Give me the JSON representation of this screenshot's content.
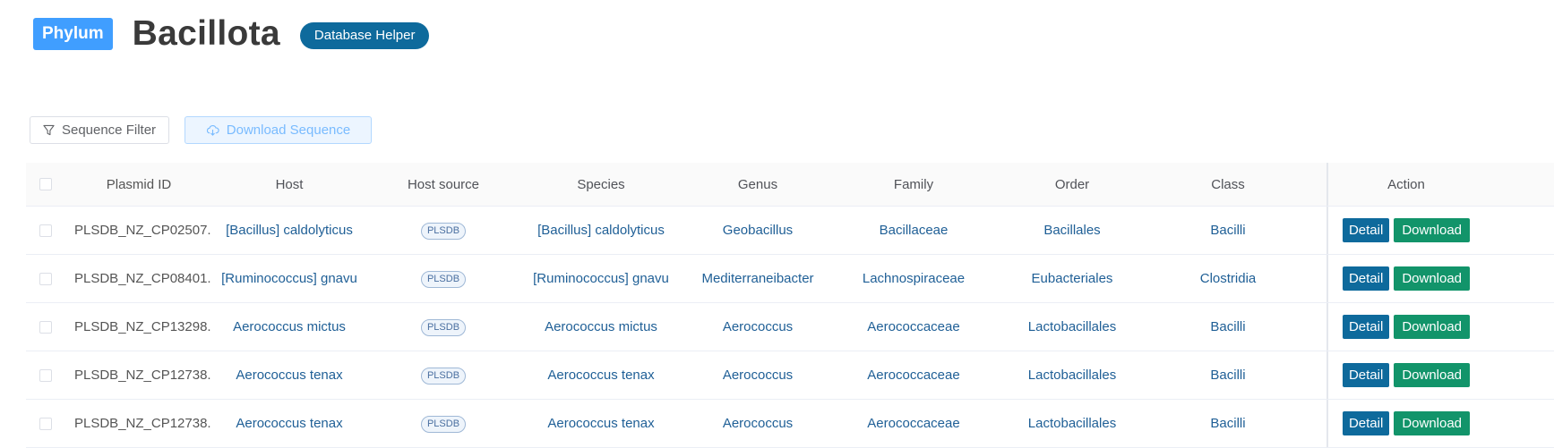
{
  "header": {
    "badge": "Phylum",
    "title": "Bacillota",
    "helper_button": "Database Helper"
  },
  "toolbar": {
    "filter_label": "Sequence Filter",
    "download_label": "Download Sequence"
  },
  "table": {
    "columns": [
      "Plasmid ID",
      "Host",
      "Host source",
      "Species",
      "Genus",
      "Family",
      "Order",
      "Class",
      "Action"
    ],
    "rows": [
      {
        "id": "PLSDB_NZ_CP02507...",
        "host": "[Bacillus] caldolyticus",
        "source": "PLSDB",
        "species": "[Bacillus] caldolyticus",
        "genus": "Geobacillus",
        "family": "Bacillaceae",
        "order": "Bacillales",
        "class": "Bacilli"
      },
      {
        "id": "PLSDB_NZ_CP08401...",
        "host": "[Ruminococcus] gnavu",
        "source": "PLSDB",
        "species": "[Ruminococcus] gnavu",
        "genus": "Mediterraneibacter",
        "family": "Lachnospiraceae",
        "order": "Eubacteriales",
        "class": "Clostridia"
      },
      {
        "id": "PLSDB_NZ_CP13298...",
        "host": "Aerococcus mictus",
        "source": "PLSDB",
        "species": "Aerococcus mictus",
        "genus": "Aerococcus",
        "family": "Aerococcaceae",
        "order": "Lactobacillales",
        "class": "Bacilli"
      },
      {
        "id": "PLSDB_NZ_CP12738...",
        "host": "Aerococcus tenax",
        "source": "PLSDB",
        "species": "Aerococcus tenax",
        "genus": "Aerococcus",
        "family": "Aerococcaceae",
        "order": "Lactobacillales",
        "class": "Bacilli"
      },
      {
        "id": "PLSDB_NZ_CP12738...",
        "host": "Aerococcus tenax",
        "source": "PLSDB",
        "species": "Aerococcus tenax",
        "genus": "Aerococcus",
        "family": "Aerococcaceae",
        "order": "Lactobacillales",
        "class": "Bacilli"
      }
    ],
    "detail_label": "Detail",
    "download_label": "Download"
  },
  "colors": {
    "primary": "#0e6a9c",
    "success": "#12946a",
    "badge": "#409eff",
    "link": "#1f5f96"
  },
  "icons": {
    "filter": "filter-icon",
    "download": "cloud-download-icon"
  }
}
